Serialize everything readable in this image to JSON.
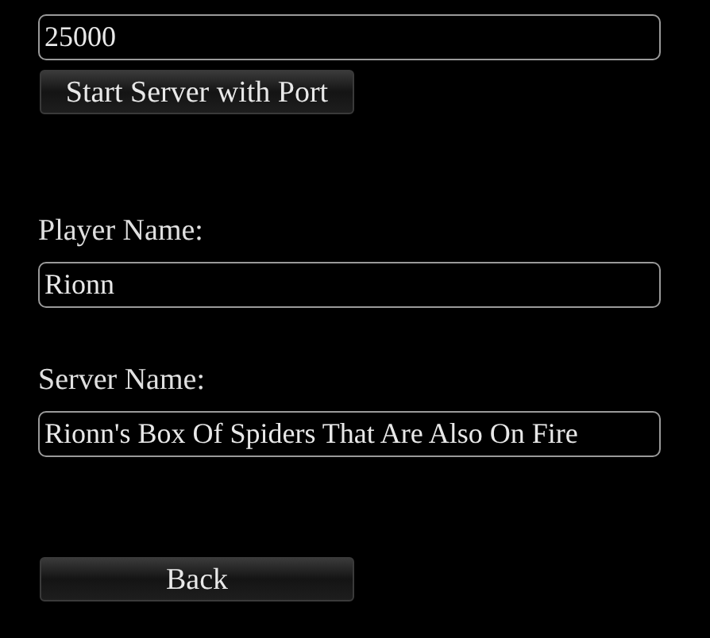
{
  "port_field": {
    "value": "25000"
  },
  "start_button": {
    "label": "Start Server with Port"
  },
  "fields": [
    {
      "label": "Player Name:",
      "value": "Rionn"
    },
    {
      "label": "Server Name:",
      "value": "Rionn's Box Of Spiders That Are Also On Fire"
    }
  ],
  "back_button": {
    "label": "Back"
  }
}
